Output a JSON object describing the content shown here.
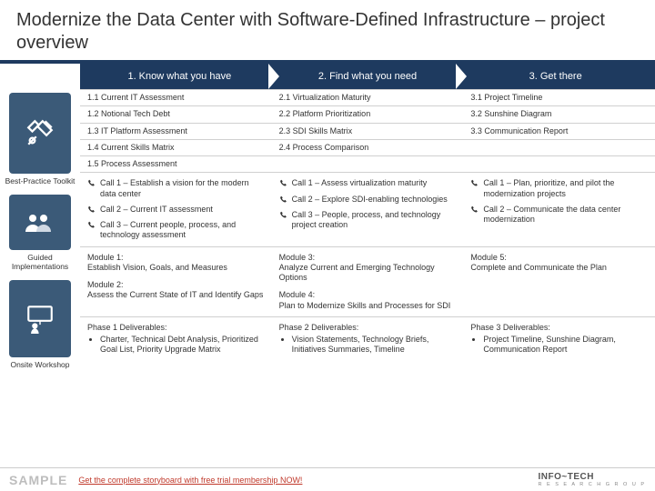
{
  "title": "Modernize the Data Center with Software-Defined Infrastructure – project overview",
  "sections": {
    "bp": "Best-Practice Toolkit",
    "gi": "Guided Implementations",
    "ow": "Onsite Workshop"
  },
  "phases": {
    "p1": "1. Know what you have",
    "p2": "2. Find what you need",
    "p3": "3. Get there"
  },
  "bp_items": {
    "r1c1": "1.1 Current IT Assessment",
    "r1c2": "2.1 Virtualization Maturity",
    "r1c3": "3.1 Project Timeline",
    "r2c1": "1.2 Notional Tech Debt",
    "r2c2": "2.2 Platform Prioritization",
    "r2c3": "3.2 Sunshine Diagram",
    "r3c1": "1.3 IT Platform Assessment",
    "r3c2": "2.3 SDI Skills Matrix",
    "r3c3": "3.3 Communication Report",
    "r4c1": "1.4 Current Skills Matrix",
    "r4c2": "2.4 Process Comparison",
    "r4c3": "",
    "r5c1": "1.5 Process Assessment",
    "r5c2": "",
    "r5c3": ""
  },
  "calls": {
    "p1c1": "Call 1 – Establish a vision for the modern data center",
    "p1c2": "Call 2 – Current IT assessment",
    "p1c3": "Call 3 – Current people, process, and technology assessment",
    "p2c1": "Call 1 – Assess virtualization maturity",
    "p2c2": "Call 2 – Explore SDI-enabling technologies",
    "p2c3": "Call 3 – People, process, and technology project creation",
    "p3c1": "Call 1 – Plan, prioritize, and pilot the modernization projects",
    "p3c2": "Call 2 – Communicate the data center modernization"
  },
  "modules": {
    "m1t": "Module 1:",
    "m1d": "Establish Vision, Goals, and Measures",
    "m2t": "Module 2:",
    "m2d": "Assess the Current State of IT and Identify Gaps",
    "m3t": "Module 3:",
    "m3d": "Analyze Current and Emerging Technology Options",
    "m4t": "Module 4:",
    "m4d": "Plan to Modernize Skills and Processes for SDI",
    "m5t": "Module 5:",
    "m5d": "Complete and Communicate the Plan"
  },
  "deliv": {
    "d1t": "Phase 1 Deliverables:",
    "d1i": "Charter, Technical Debt Analysis, Prioritized Goal List, Priority Upgrade Matrix",
    "d2t": "Phase 2 Deliverables:",
    "d2i": "Vision Statements, Technology Briefs, Initiatives Summaries, Timeline",
    "d3t": "Phase 3 Deliverables:",
    "d3i": "Project Timeline, Sunshine Diagram, Communication Report"
  },
  "footer": {
    "sample": "SAMPLE",
    "cta": "Get the complete storyboard with free trial membership NOW!",
    "logo_main": "INFO~TECH",
    "logo_sub": "R E S E A R C H   G R O U P"
  }
}
